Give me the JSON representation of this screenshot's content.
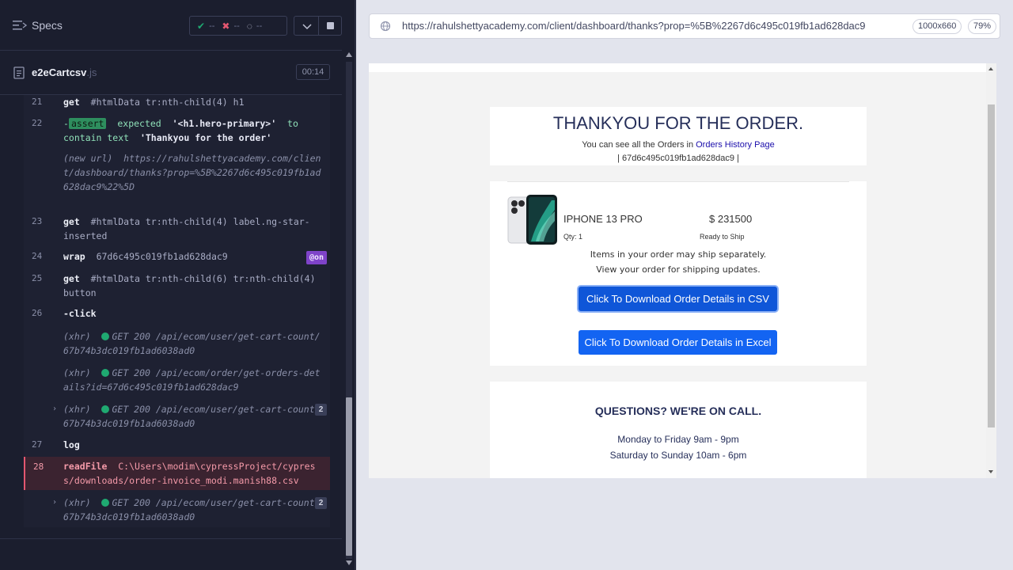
{
  "reporter": {
    "specs_label": "Specs",
    "stats": {
      "passed": "--",
      "failed": "--",
      "pending": "--"
    },
    "spec_name": "e2eCartcsv",
    "spec_ext": ".js",
    "duration": "00:14",
    "commands": [
      {
        "num": "21",
        "name": "get",
        "detail": "#htmlData tr:nth-child(4) h1"
      },
      {
        "num": "22",
        "name": "assert",
        "prefix": "-",
        "expected_word": "expected",
        "expected_value": "'<h1.hero-primary>'",
        "to_word": "to",
        "contain_text": "contain text",
        "contain_value": "'Thankyou for the order'"
      },
      {
        "num": "",
        "name": "(new url)",
        "detail": "https://rahulshettyacademy.com/client/dashboard/thanks?prop=%5B%2267d6c495c019fb1ad628dac9%22%5D"
      },
      {
        "num": "23",
        "name": "get",
        "detail": "#htmlData tr:nth-child(4) label.ng-star-inserted"
      },
      {
        "num": "24",
        "name": "wrap",
        "detail": "67d6c495c019fb1ad628dac9",
        "badge": "@on"
      },
      {
        "num": "25",
        "name": "get",
        "detail": "#htmlData tr:nth-child(6) tr:nth-child(4) button"
      },
      {
        "num": "26",
        "name": "-click",
        "detail": ""
      },
      {
        "num": "",
        "name": "(xhr)",
        "detail": "GET 200 /api/ecom/user/get-cart-count/67b74b3dc019fb1ad6038ad0"
      },
      {
        "num": "",
        "name": "(xhr)",
        "detail": "GET 200 /api/ecom/order/get-orders-details?id=67d6c495c019fb1ad628dac9"
      },
      {
        "num": "",
        "name": "(xhr)",
        "detail": "GET 200 /api/ecom/user/get-cart-count/67b74b3dc019fb1ad6038ad0",
        "count": "2"
      },
      {
        "num": "27",
        "name": "log",
        "detail": ""
      },
      {
        "num": "28",
        "name": "readFile",
        "detail": "C:\\Users\\modim\\cypressProject/cypress/downloads/order-invoice_modi.manish88.csv"
      },
      {
        "num": "",
        "name": "(xhr)",
        "detail": "GET 200 /api/ecom/user/get-cart-count/67b74b3dc019fb1ad6038ad0",
        "count": "2"
      }
    ]
  },
  "aut": {
    "url": "https://rahulshettyacademy.com/client/dashboard/thanks?prop=%5B%2267d6c495c019fb1ad628dac9",
    "viewport": "1000x660",
    "zoom": "79%",
    "thanks_title": "THANKYOU FOR THE ORDER.",
    "thanks_sub_prefix": "You can see all the Orders in ",
    "orders_link": "Orders History Page",
    "order_id": "| 67d6c495c019fb1ad628dac9 |",
    "product": {
      "name": "IPHONE 13 PRO",
      "price": "$ 231500",
      "qty": "Qty: 1",
      "status": "Ready to Ship"
    },
    "ship_note_1": "Items in your order may ship separately.",
    "ship_note_2": "View your order for shipping updates.",
    "csv_button": "Click To Download Order Details in CSV",
    "excel_button": "Click To Download Order Details in Excel",
    "questions_title": "QUESTIONS? WE'RE ON CALL.",
    "hours_1": "Monday to Friday 9am - 9pm",
    "hours_2": "Saturday to Sunday 10am - 6pm"
  },
  "colors": {
    "reporter_bg": "#1b1e2e",
    "pass": "#1fa971",
    "fail": "#e45770",
    "button_blue": "#1364f2",
    "title_navy": "#262f5a"
  },
  "icons": [
    "specs-menu-icon",
    "check-icon",
    "x-icon",
    "spinner-icon",
    "chevron-down-icon",
    "stop-icon",
    "file-icon",
    "globe-icon",
    "caret-right-icon"
  ]
}
